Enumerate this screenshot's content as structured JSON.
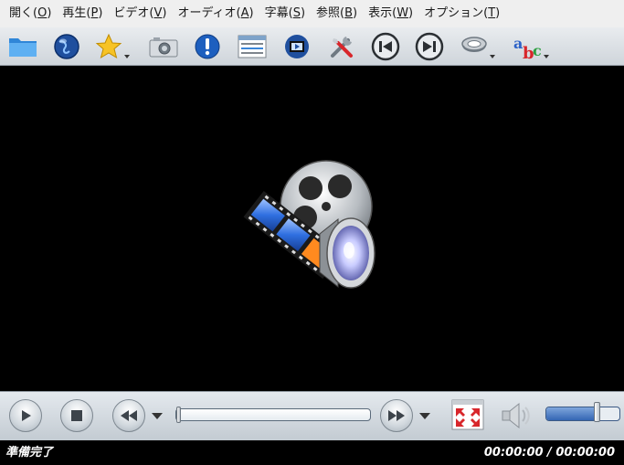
{
  "menu": [
    {
      "label": "開く(",
      "mnemonic": "O",
      "suffix": ")"
    },
    {
      "label": "再生(",
      "mnemonic": "P",
      "suffix": ")"
    },
    {
      "label": "ビデオ(",
      "mnemonic": "V",
      "suffix": ")"
    },
    {
      "label": "オーディオ(",
      "mnemonic": "A",
      "suffix": ")"
    },
    {
      "label": "字幕(",
      "mnemonic": "S",
      "suffix": ")"
    },
    {
      "label": "参照(",
      "mnemonic": "B",
      "suffix": ")"
    },
    {
      "label": "表示(",
      "mnemonic": "W",
      "suffix": ")"
    },
    {
      "label": "オプション(",
      "mnemonic": "T",
      "suffix": ")"
    }
  ],
  "toolbar_icons": [
    "folder-icon",
    "globe-icon",
    "favorites-star-icon",
    "screenshot-camera-icon",
    "info-icon",
    "playlist-icon",
    "video-equalizer-icon",
    "preferences-tools-icon",
    "previous-track-icon",
    "next-track-icon",
    "audio-track-icon",
    "subtitle-abc-icon"
  ],
  "controls": {
    "seek_position": 0.0,
    "volume_level": 0.68
  },
  "status": {
    "state": "準備完了",
    "time": "00:00:00 / 00:00:00"
  },
  "colors": {
    "video_background": "#000000",
    "volume_fill": "#3466b4",
    "close_icon_red": "#d8262b"
  }
}
